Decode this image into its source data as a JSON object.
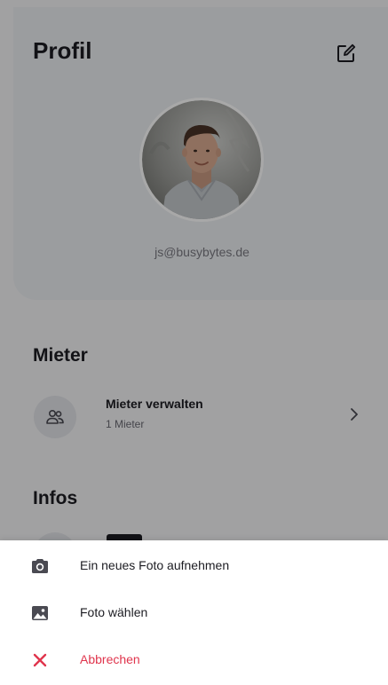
{
  "header": {
    "title": "Profil",
    "edit_icon": "edit-icon"
  },
  "profile": {
    "email": "js@busybytes.de",
    "avatar": "profile-photo"
  },
  "tenants": {
    "section_title": "Mieter",
    "item": {
      "label": "Mieter verwalten",
      "count": "1 Mieter",
      "icon": "people-icon",
      "chevron": "chevron-right-icon"
    }
  },
  "infos": {
    "section_title": "Infos"
  },
  "bottom_sheet": {
    "items": [
      {
        "label": "Ein neues Foto aufnehmen",
        "icon": "camera-icon"
      },
      {
        "label": "Foto wählen",
        "icon": "image-icon"
      },
      {
        "label": "Abbrechen",
        "icon": "close-icon"
      }
    ]
  },
  "colors": {
    "accent_danger": "#e0354d",
    "text_primary": "#1c1c22",
    "scrim": "rgba(0,0,0,0.34)"
  }
}
